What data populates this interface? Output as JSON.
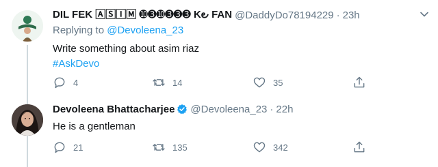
{
  "tweets": [
    {
      "display_name": "DIL FEK 🄰🅂🄸🄼 ➓➌➓➌➌➌ K౿ FAN",
      "handle": "@DaddyDo78194229",
      "separator": "·",
      "time": "23h",
      "replying_prefix": "Replying to",
      "replying_handle": "@Devoleena_23",
      "text": "Write something about asim riaz",
      "hashtag": "#AskDevo",
      "replies": "4",
      "retweets": "14",
      "likes": "35",
      "verified": false
    },
    {
      "display_name": "Devoleena Bhattacharjee",
      "handle": "@Devoleena_23",
      "separator": "·",
      "time": "22h",
      "text": "He is a gentleman",
      "replies": "21",
      "retweets": "135",
      "likes": "342",
      "verified": true
    }
  ],
  "colors": {
    "accent": "#1da1f2",
    "secondary_text": "#657786",
    "primary_text": "#14171a",
    "thread_line": "#cfd9de"
  },
  "icons": [
    "reply-icon",
    "retweet-icon",
    "like-icon",
    "share-icon",
    "verified-badge-icon",
    "chevron-down-icon"
  ]
}
